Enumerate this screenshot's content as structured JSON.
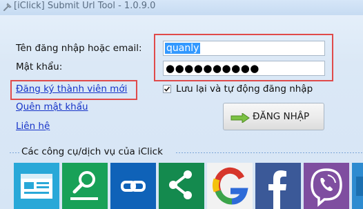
{
  "window": {
    "title": "[iClick] Submit Url Tool - 1.0.9.0"
  },
  "login": {
    "username_label": "Tên đăng nhập hoặc email:",
    "username_value": "quanly",
    "password_label": "Mật khẩu:",
    "password_mask": "●●●●●●●●●●",
    "remember_label": "Lưu lại và tự động đăng nhập",
    "remember_checked": true,
    "login_button": "ĐĂNG NHẬP"
  },
  "links": {
    "register": "Đăng ký thành viên mới",
    "forgot_password": "Quên mật khẩu",
    "contact": "Liên hệ"
  },
  "tools": {
    "section_title": "Các công cụ/dịch vụ của iClick",
    "items": [
      {
        "icon": "web-browser-icon",
        "color": "#29a8d8"
      },
      {
        "icon": "magnifier-icon",
        "color": "#18a158"
      },
      {
        "icon": "link-chain-icon",
        "color": "#0f62b8"
      },
      {
        "icon": "share-icon",
        "color": "#148a4e"
      },
      {
        "icon": "google-icon",
        "color": "#f2f2f2"
      },
      {
        "icon": "facebook-icon",
        "color": "#3b5998"
      },
      {
        "icon": "viber-icon",
        "color": "#7f4ea0"
      },
      {
        "icon": "partial-tile",
        "color": "#2d8bd0"
      }
    ]
  },
  "colors": {
    "highlight_box": "#e04a4a",
    "link": "#1633c8",
    "selection": "#3399ff"
  }
}
